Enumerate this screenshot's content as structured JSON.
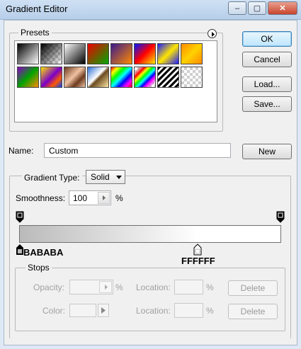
{
  "window": {
    "title": "Gradient Editor",
    "min_symbol": "–",
    "max_symbol": "▢",
    "close_symbol": "✕"
  },
  "presets": {
    "label": "Presets",
    "menu_icon": "circle-arrow-menu-icon",
    "swatch_names": [
      "black-white",
      "black-transparent",
      "black-white-2",
      "red-green",
      "violet-orange",
      "blue-red-yellow",
      "blue-yellow-blue",
      "orange-yellow",
      "violet-green-orange",
      "yellow-violet-orange-blue",
      "copper",
      "chrome",
      "spectrum",
      "transparent-rainbow",
      "transparent-stripes",
      "transparent"
    ]
  },
  "buttons": {
    "ok": "OK",
    "cancel": "Cancel",
    "load": "Load...",
    "save": "Save...",
    "new": "New"
  },
  "name": {
    "label": "Name:",
    "value": "Custom"
  },
  "gradient": {
    "type_label": "Gradient Type:",
    "type_value": "Solid",
    "smoothness_label": "Smoothness:",
    "smoothness_value": "100",
    "percent": "%",
    "left_color_stop": "BABABA",
    "right_color_stop": "FFFFFF",
    "right_color_stop_position": 0.68,
    "colors": {
      "start": "#BABABA",
      "end": "#FFFFFF"
    }
  },
  "stops": {
    "label": "Stops",
    "opacity_label": "Opacity:",
    "color_label": "Color:",
    "location_label": "Location:",
    "percent": "%",
    "delete": "Delete"
  }
}
